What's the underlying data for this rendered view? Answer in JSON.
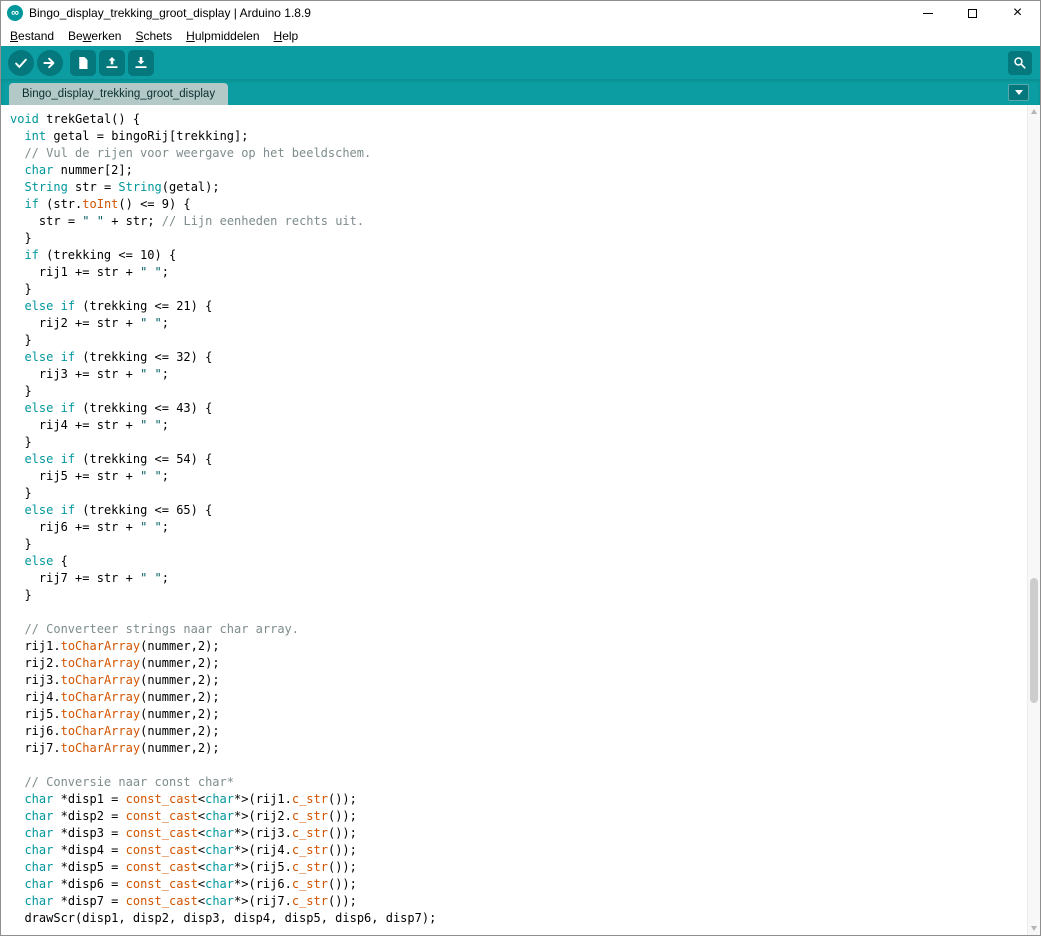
{
  "colors": {
    "accent": "#00979C",
    "toolbar-bg": "#0b9da1",
    "button-bg": "#04787d",
    "tab-bg": "#b2c9c8",
    "keyword": "#00979C",
    "function": "#D35400",
    "comment": "#7e8c8d",
    "string": "#005C5F",
    "code-text": "#000000"
  },
  "window": {
    "title": "Bingo_display_trekking_groot_display | Arduino 1.8.9",
    "app_icon": "arduino-infinity-icon",
    "app_icon_glyph": "∞",
    "controls": {
      "minimize_icon": "minimize-icon",
      "maximize_icon": "maximize-icon",
      "close_icon": "close-icon",
      "close_glyph": "×"
    }
  },
  "menu": {
    "items": [
      {
        "label": "Bestand",
        "underline": 0
      },
      {
        "label": "Bewerken",
        "underline": 2
      },
      {
        "label": "Schets",
        "underline": 0
      },
      {
        "label": "Hulpmiddelen",
        "underline": 0
      },
      {
        "label": "Help",
        "underline": 0
      }
    ]
  },
  "toolbar": {
    "buttons": [
      {
        "name": "verify",
        "icon": "checkmark-icon",
        "shape": "circle"
      },
      {
        "name": "upload",
        "icon": "arrow-right-icon",
        "shape": "circle"
      },
      {
        "name": "new-sketch",
        "icon": "document-icon",
        "shape": "square"
      },
      {
        "name": "open-sketch",
        "icon": "arrow-up-tray-icon",
        "shape": "square"
      },
      {
        "name": "save-sketch",
        "icon": "arrow-down-tray-icon",
        "shape": "square"
      }
    ],
    "right_buttons": [
      {
        "name": "serial-monitor",
        "icon": "magnifier-icon",
        "shape": "square"
      }
    ]
  },
  "tabs": {
    "active_label": "Bingo_display_trekking_groot_display",
    "dropdown_icon": "chevron-down-icon"
  },
  "editor": {
    "syntax": {
      "keywords": [
        "void",
        "int",
        "char",
        "String",
        "if",
        "else"
      ],
      "functions": [
        "toInt",
        "toCharArray",
        "c_str",
        "const_cast"
      ]
    },
    "code_lines": [
      "void trekGetal() {",
      "  int getal = bingoRij[trekking];",
      "  // Vul de rijen voor weergave op het beeldschem.",
      "  char nummer[2];",
      "  String str = String(getal);",
      "  if (str.toInt() <= 9) {",
      "    str = \" \" + str; // Lijn eenheden rechts uit.",
      "  }",
      "  if (trekking <= 10) {",
      "    rij1 += str + \" \";",
      "  }",
      "  else if (trekking <= 21) {",
      "    rij2 += str + \" \";",
      "  }",
      "  else if (trekking <= 32) {",
      "    rij3 += str + \" \";",
      "  }",
      "  else if (trekking <= 43) {",
      "    rij4 += str + \" \";",
      "  }",
      "  else if (trekking <= 54) {",
      "    rij5 += str + \" \";",
      "  }",
      "  else if (trekking <= 65) {",
      "    rij6 += str + \" \";",
      "  }",
      "  else {",
      "    rij7 += str + \" \";",
      "  }",
      "",
      "  // Converteer strings naar char array.",
      "  rij1.toCharArray(nummer,2);",
      "  rij2.toCharArray(nummer,2);",
      "  rij3.toCharArray(nummer,2);",
      "  rij4.toCharArray(nummer,2);",
      "  rij5.toCharArray(nummer,2);",
      "  rij6.toCharArray(nummer,2);",
      "  rij7.toCharArray(nummer,2);",
      "",
      "  // Conversie naar const char*",
      "  char *disp1 = const_cast<char*>(rij1.c_str());",
      "  char *disp2 = const_cast<char*>(rij2.c_str());",
      "  char *disp3 = const_cast<char*>(rij3.c_str());",
      "  char *disp4 = const_cast<char*>(rij4.c_str());",
      "  char *disp5 = const_cast<char*>(rij5.c_str());",
      "  char *disp6 = const_cast<char*>(rij6.c_str());",
      "  char *disp7 = const_cast<char*>(rij7.c_str());",
      "  drawScr(disp1, disp2, disp3, disp4, disp5, disp6, disp7);"
    ]
  }
}
